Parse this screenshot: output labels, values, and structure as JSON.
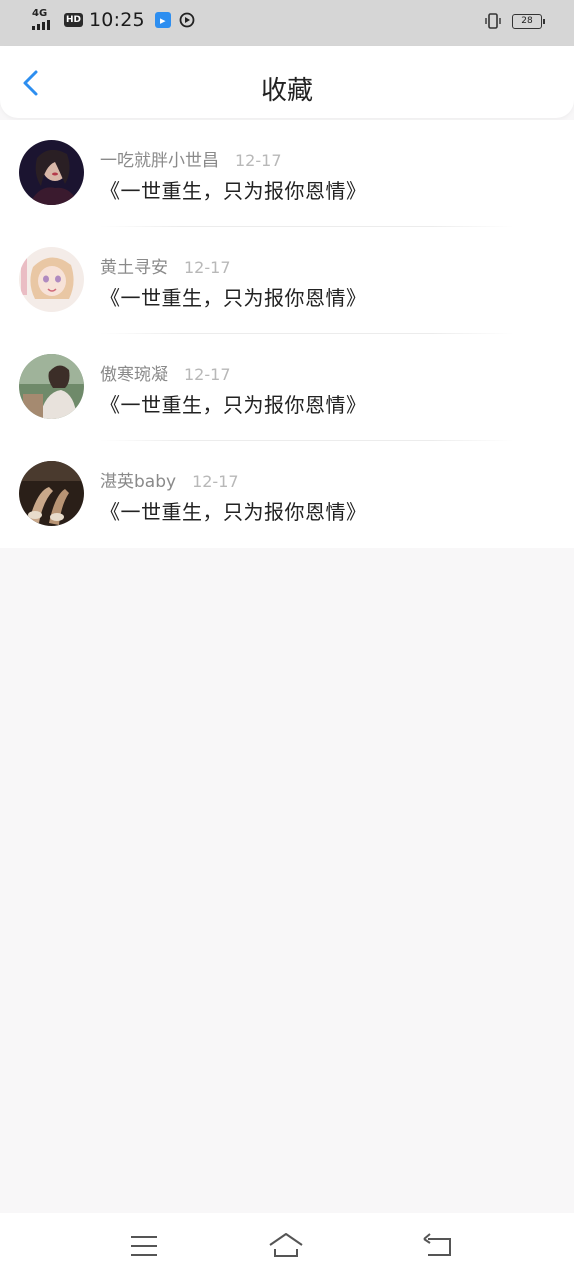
{
  "status_bar": {
    "network": "4G",
    "hd": "HD",
    "time": "10:25",
    "battery": "28",
    "icons": [
      "signal-icon",
      "hd-icon",
      "app-notification-icon",
      "play-notification-icon",
      "vibrate-icon",
      "battery-icon"
    ]
  },
  "header": {
    "title": "收藏",
    "back_icon": "back-chevron-icon",
    "accent": "#2d8ef0"
  },
  "favorites": [
    {
      "username": "一吃就胖小世昌",
      "date": "12-17",
      "content": "《一世重生，只为报你恩情》"
    },
    {
      "username": "黄土寻安",
      "date": "12-17",
      "content": "《一世重生，只为报你恩情》"
    },
    {
      "username": "傲寒琬凝",
      "date": "12-17",
      "content": "《一世重生，只为报你恩情》"
    },
    {
      "username": "湛英baby",
      "date": "12-17",
      "content": "《一世重生，只为报你恩情》"
    }
  ],
  "nav_bar": {
    "icons": [
      "menu-icon",
      "home-icon",
      "back-icon"
    ]
  }
}
